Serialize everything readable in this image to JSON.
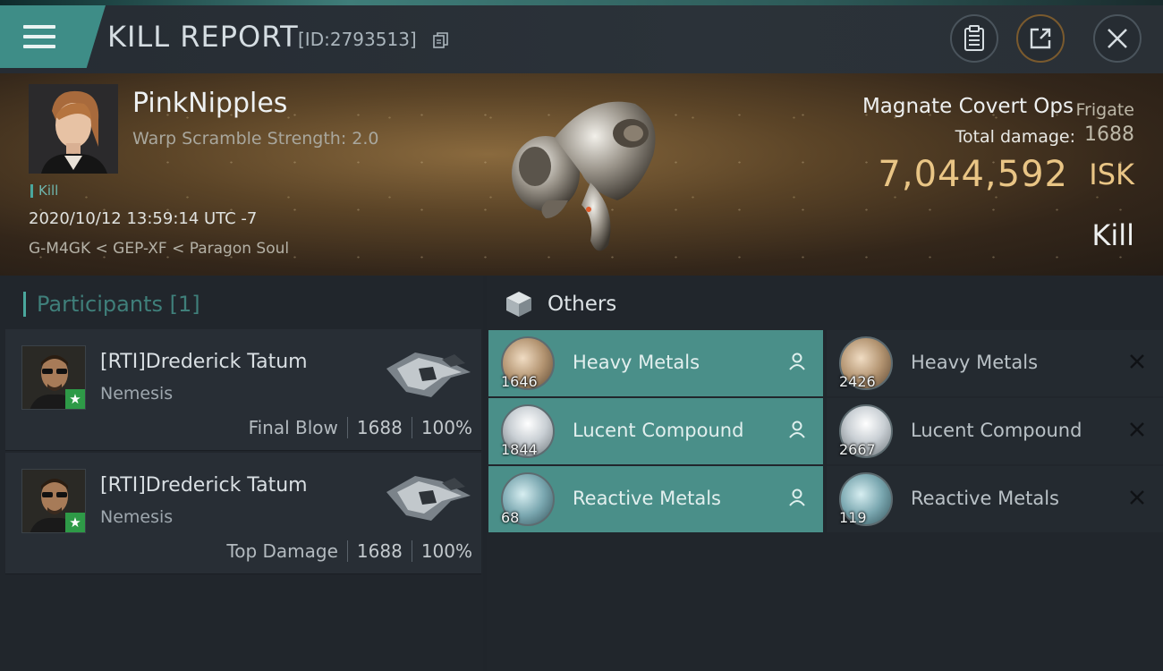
{
  "header": {
    "title": "KILL REPORT",
    "report_id": "[ID:2793513]"
  },
  "victim": {
    "name": "PinkNipples",
    "warp_scramble": "Warp Scramble Strength: 2.0",
    "tag": "Kill",
    "date": "2020/10/12 13:59:14 UTC -7",
    "location": "G-M4GK < GEP-XF < Paragon Soul",
    "ship_name": "Magnate Covert Ops",
    "ship_class": "Frigate",
    "total_damage_label": "Total damage:",
    "total_damage": "1688",
    "isk_value": "7,044,592",
    "isk_unit": "ISK",
    "status": "Kill"
  },
  "participants": {
    "header": "Participants [1]",
    "items": [
      {
        "name": "[RTI]Drederick Tatum",
        "ship": "Nemesis",
        "role": "Final Blow",
        "damage": "1688",
        "percent": "100%"
      },
      {
        "name": "[RTI]Drederick Tatum",
        "ship": "Nemesis",
        "role": "Top Damage",
        "damage": "1688",
        "percent": "100%"
      }
    ]
  },
  "others": {
    "title": "Others",
    "items": [
      {
        "name": "Heavy Metals",
        "qty": "1646",
        "state": "dropped",
        "icon": "heavy-metals-icon"
      },
      {
        "name": "Heavy Metals",
        "qty": "2426",
        "state": "destroyed",
        "icon": "heavy-metals-icon"
      },
      {
        "name": "Lucent Compound",
        "qty": "1844",
        "state": "dropped",
        "icon": "lucent-compound-icon"
      },
      {
        "name": "Lucent Compound",
        "qty": "2667",
        "state": "destroyed",
        "icon": "lucent-compound-icon"
      },
      {
        "name": "Reactive Metals",
        "qty": "68",
        "state": "dropped",
        "icon": "reactive-metals-icon"
      },
      {
        "name": "Reactive Metals",
        "qty": "119",
        "state": "destroyed",
        "icon": "reactive-metals-icon"
      }
    ]
  },
  "colors": {
    "accent": "#4a8f89",
    "isk_gold": "#e9c585",
    "star_badge": "#2e9a47"
  }
}
